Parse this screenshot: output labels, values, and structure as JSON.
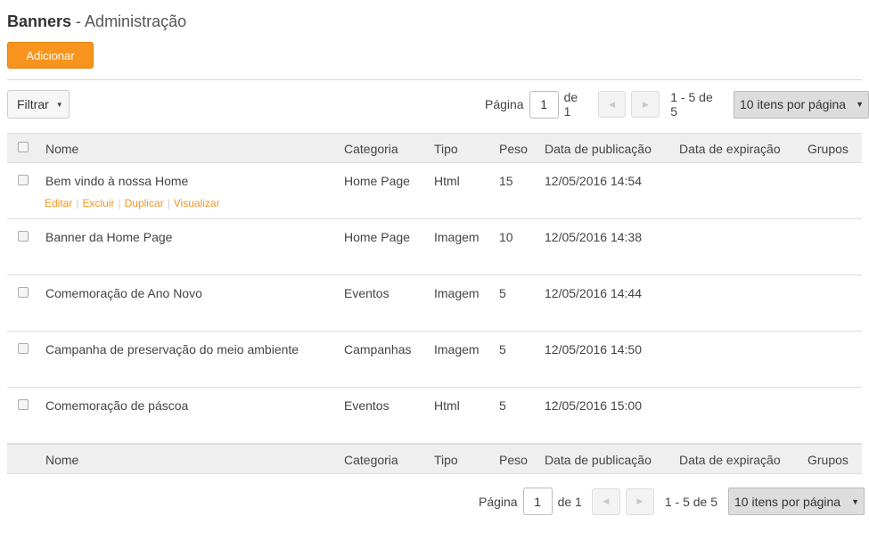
{
  "header": {
    "title_bold": "Banners",
    "title_rest": "- Administração"
  },
  "toolbar": {
    "add_label": "Adicionar",
    "filter_label": "Filtrar"
  },
  "pagination": {
    "page_label": "Página",
    "page_value": "1",
    "of_label": "de 1",
    "range": "1 - 5 de 5",
    "per_page": "10 itens por página"
  },
  "columns": {
    "name": "Nome",
    "category": "Categoria",
    "type": "Tipo",
    "weight": "Peso",
    "published": "Data de publicação",
    "expires": "Data de expiração",
    "groups": "Grupos"
  },
  "row_actions": [
    "Editar",
    "Excluir",
    "Duplicar",
    "Visualizar"
  ],
  "rows": [
    {
      "name": "Bem vindo à nossa Home",
      "category": "Home Page",
      "type": "Html",
      "weight": "15",
      "published": "12/05/2016 14:54",
      "expires": "",
      "groups": ""
    },
    {
      "name": "Banner da Home Page",
      "category": "Home Page",
      "type": "Imagem",
      "weight": "10",
      "published": "12/05/2016 14:38",
      "expires": "",
      "groups": ""
    },
    {
      "name": "Comemoração de Ano Novo",
      "category": "Eventos",
      "type": "Imagem",
      "weight": "5",
      "published": "12/05/2016 14:44",
      "expires": "",
      "groups": ""
    },
    {
      "name": "Campanha de preservação do meio ambiente",
      "category": "Campanhas",
      "type": "Imagem",
      "weight": "5",
      "published": "12/05/2016 14:50",
      "expires": "",
      "groups": ""
    },
    {
      "name": "Comemoração de páscoa",
      "category": "Eventos",
      "type": "Html",
      "weight": "5",
      "published": "12/05/2016 15:00",
      "expires": "",
      "groups": ""
    }
  ]
}
